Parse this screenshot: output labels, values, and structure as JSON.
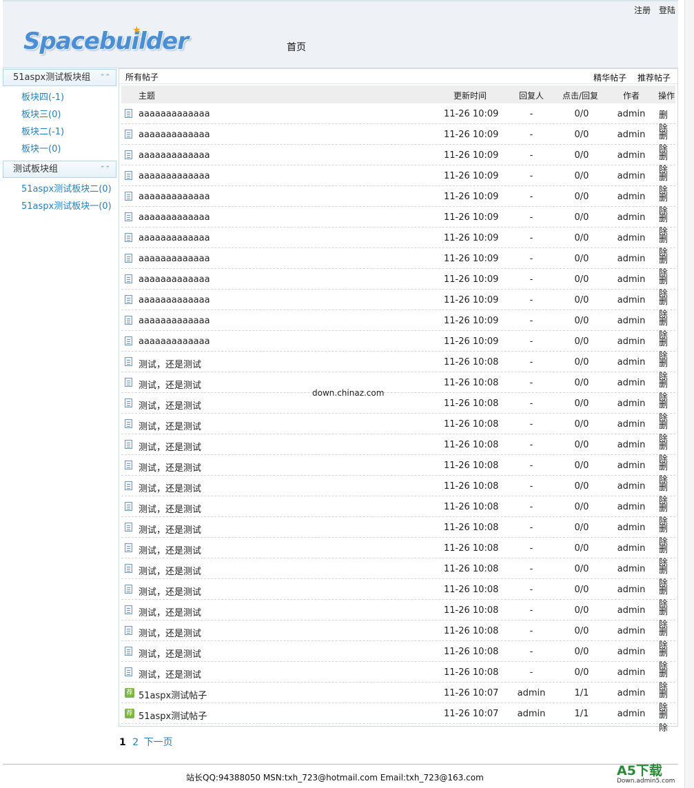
{
  "header": {
    "logo_text": "Spacebuilder",
    "register": "注册",
    "login": "登陆",
    "nav_home": "首页"
  },
  "sidebar": {
    "groups": [
      {
        "title": "51aspx测试板块组",
        "items": [
          "板块四(-1)",
          "板块三(0)",
          "板块二(-1)",
          "板块一(0)"
        ]
      },
      {
        "title": "测试板块组",
        "items": [
          "51aspx测试板块二(0)",
          "51aspx测试板块一(0)"
        ]
      }
    ]
  },
  "main": {
    "tab_all": "所有帖子",
    "tab_elite": "精华帖子",
    "tab_recommended": "推荐帖子",
    "columns": {
      "subject": "主题",
      "updated": "更新时间",
      "replier": "回复人",
      "hits_replies": "点击/回复",
      "author": "作者",
      "action": "操作"
    },
    "rows": [
      {
        "icon": "doc",
        "title": "aaaaaaaaaaaaa",
        "time": "11-26 10:09",
        "replier": "-",
        "stats": "0/0",
        "author": "admin",
        "action": "删除"
      },
      {
        "icon": "doc",
        "title": "aaaaaaaaaaaaa",
        "time": "11-26 10:09",
        "replier": "-",
        "stats": "0/0",
        "author": "admin",
        "action": "删除"
      },
      {
        "icon": "doc",
        "title": "aaaaaaaaaaaaa",
        "time": "11-26 10:09",
        "replier": "-",
        "stats": "0/0",
        "author": "admin",
        "action": "删除"
      },
      {
        "icon": "doc",
        "title": "aaaaaaaaaaaaa",
        "time": "11-26 10:09",
        "replier": "-",
        "stats": "0/0",
        "author": "admin",
        "action": "删除"
      },
      {
        "icon": "doc",
        "title": "aaaaaaaaaaaaa",
        "time": "11-26 10:09",
        "replier": "-",
        "stats": "0/0",
        "author": "admin",
        "action": "删除"
      },
      {
        "icon": "doc",
        "title": "aaaaaaaaaaaaa",
        "time": "11-26 10:09",
        "replier": "-",
        "stats": "0/0",
        "author": "admin",
        "action": "删除"
      },
      {
        "icon": "doc",
        "title": "aaaaaaaaaaaaa",
        "time": "11-26 10:09",
        "replier": "-",
        "stats": "0/0",
        "author": "admin",
        "action": "删除"
      },
      {
        "icon": "doc",
        "title": "aaaaaaaaaaaaa",
        "time": "11-26 10:09",
        "replier": "-",
        "stats": "0/0",
        "author": "admin",
        "action": "删除"
      },
      {
        "icon": "doc",
        "title": "aaaaaaaaaaaaa",
        "time": "11-26 10:09",
        "replier": "-",
        "stats": "0/0",
        "author": "admin",
        "action": "删除"
      },
      {
        "icon": "doc",
        "title": "aaaaaaaaaaaaa",
        "time": "11-26 10:09",
        "replier": "-",
        "stats": "0/0",
        "author": "admin",
        "action": "删除"
      },
      {
        "icon": "doc",
        "title": "aaaaaaaaaaaaa",
        "time": "11-26 10:09",
        "replier": "-",
        "stats": "0/0",
        "author": "admin",
        "action": "删除"
      },
      {
        "icon": "doc",
        "title": "aaaaaaaaaaaaa",
        "time": "11-26 10:09",
        "replier": "-",
        "stats": "0/0",
        "author": "admin",
        "action": "删除"
      },
      {
        "icon": "doc",
        "title": "测试，还是测试",
        "time": "11-26 10:08",
        "replier": "-",
        "stats": "0/0",
        "author": "admin",
        "action": "删除"
      },
      {
        "icon": "doc",
        "title": "测试，还是测试",
        "time": "11-26 10:08",
        "replier": "-",
        "stats": "0/0",
        "author": "admin",
        "action": "删除"
      },
      {
        "icon": "doc",
        "title": "测试，还是测试",
        "time": "11-26 10:08",
        "replier": "-",
        "stats": "0/0",
        "author": "admin",
        "action": "删除"
      },
      {
        "icon": "doc",
        "title": "测试，还是测试",
        "time": "11-26 10:08",
        "replier": "-",
        "stats": "0/0",
        "author": "admin",
        "action": "删除"
      },
      {
        "icon": "doc",
        "title": "测试，还是测试",
        "time": "11-26 10:08",
        "replier": "-",
        "stats": "0/0",
        "author": "admin",
        "action": "删除"
      },
      {
        "icon": "doc",
        "title": "测试，还是测试",
        "time": "11-26 10:08",
        "replier": "-",
        "stats": "0/0",
        "author": "admin",
        "action": "删除"
      },
      {
        "icon": "doc",
        "title": "测试，还是测试",
        "time": "11-26 10:08",
        "replier": "-",
        "stats": "0/0",
        "author": "admin",
        "action": "删除"
      },
      {
        "icon": "doc",
        "title": "测试，还是测试",
        "time": "11-26 10:08",
        "replier": "-",
        "stats": "0/0",
        "author": "admin",
        "action": "删除"
      },
      {
        "icon": "doc",
        "title": "测试，还是测试",
        "time": "11-26 10:08",
        "replier": "-",
        "stats": "0/0",
        "author": "admin",
        "action": "删除"
      },
      {
        "icon": "doc",
        "title": "测试，还是测试",
        "time": "11-26 10:08",
        "replier": "-",
        "stats": "0/0",
        "author": "admin",
        "action": "删除"
      },
      {
        "icon": "doc",
        "title": "测试，还是测试",
        "time": "11-26 10:08",
        "replier": "-",
        "stats": "0/0",
        "author": "admin",
        "action": "删除"
      },
      {
        "icon": "doc",
        "title": "测试，还是测试",
        "time": "11-26 10:08",
        "replier": "-",
        "stats": "0/0",
        "author": "admin",
        "action": "删除"
      },
      {
        "icon": "doc",
        "title": "测试，还是测试",
        "time": "11-26 10:08",
        "replier": "-",
        "stats": "0/0",
        "author": "admin",
        "action": "删除"
      },
      {
        "icon": "doc",
        "title": "测试，还是测试",
        "time": "11-26 10:08",
        "replier": "-",
        "stats": "0/0",
        "author": "admin",
        "action": "删除"
      },
      {
        "icon": "doc",
        "title": "测试，还是测试",
        "time": "11-26 10:08",
        "replier": "-",
        "stats": "0/0",
        "author": "admin",
        "action": "删除"
      },
      {
        "icon": "doc",
        "title": "测试，还是测试",
        "time": "11-26 10:08",
        "replier": "-",
        "stats": "0/0",
        "author": "admin",
        "action": "删除"
      },
      {
        "icon": "rec",
        "title": "51aspx测试帖子",
        "time": "11-26 10:07",
        "replier": "admin",
        "stats": "1/1",
        "author": "admin",
        "action": "删除"
      },
      {
        "icon": "rec",
        "title": "51aspx测试帖子",
        "time": "11-26 10:07",
        "replier": "admin",
        "stats": "1/1",
        "author": "admin",
        "action": "删除"
      }
    ],
    "rec_icon_text": "荐",
    "watermark": "down.chinaz.com"
  },
  "pager": {
    "current": "1",
    "page2": "2",
    "next": "下一页"
  },
  "footer": {
    "contact": "站长QQ:94388050 MSN:txh_723@hotmail.com Email:txh_723@163.com",
    "a5_logo": "A5下载",
    "a5_sub": "Down.admin5.com"
  },
  "colors": {
    "link": "#2a7fb5",
    "header_bg": "#eef2f6",
    "logo": "#4a8ed6",
    "rec_icon": "#7db64a"
  }
}
